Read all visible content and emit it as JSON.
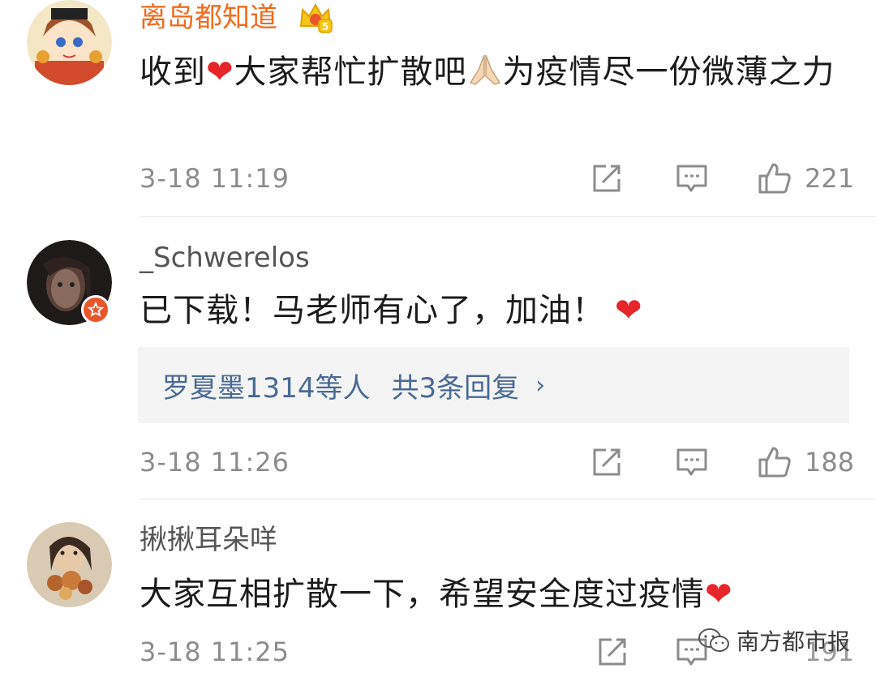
{
  "comments": [
    {
      "username": "离岛都知道",
      "vip_level": "5",
      "text_before": "收到",
      "text_mid": "大家帮忙扩散吧",
      "text_after": "为疫情尽一份微薄之力",
      "time": "3-18 11:19",
      "likes": "221"
    },
    {
      "username": "_Schwerelos",
      "text": "已下载！马老师有心了，加油！",
      "replies": {
        "who": "罗夏墨1314等人",
        "count": "共3条回复",
        "chevron": "›"
      },
      "time": "3-18 11:26",
      "likes": "188"
    },
    {
      "username": "揪揪耳朵咩",
      "text": "大家互相扩散一下，希望安全度过疫情",
      "time": "3-18 11:25",
      "likes": "191"
    }
  ],
  "icons": {
    "heart": "❤",
    "share": "share-icon",
    "reply": "comment-icon",
    "like": "thumbs-up-icon"
  },
  "watermark": {
    "text": "南方都市报"
  },
  "colors": {
    "vip_name": "#f26b1d",
    "link_blue": "#4a6a96",
    "meta_gray": "#8c8c8c",
    "heart_red": "#e6262b",
    "badge_orange": "#e8562a"
  }
}
